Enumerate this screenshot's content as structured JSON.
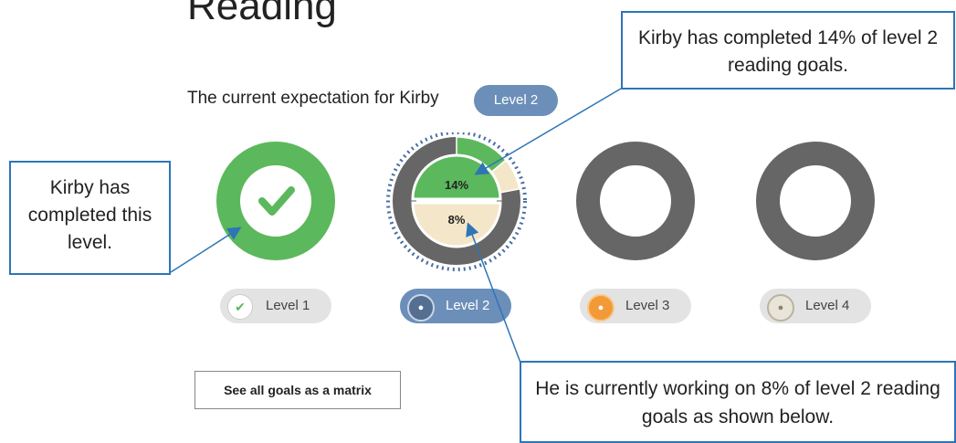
{
  "page": {
    "title": "Reading",
    "expectation_text": "The current expectation for Kirby",
    "expectation_badge": "Level 2"
  },
  "levels": [
    {
      "label": "Level 1",
      "state": "completed",
      "icon": "check-icon"
    },
    {
      "label": "Level 2",
      "state": "current",
      "icon": "level-2-badge-icon",
      "completed_pct": 14,
      "working_pct": 8,
      "completed_label": "14%",
      "working_label": "8%"
    },
    {
      "label": "Level 3",
      "state": "not-started",
      "icon": "level-3-badge-icon"
    },
    {
      "label": "Level 4",
      "state": "not-started",
      "icon": "level-4-badge-icon"
    }
  ],
  "buttons": {
    "matrix": "See all goals as a matrix"
  },
  "callouts": {
    "completed_pct": "Kirby has completed 14% of level 2 reading goals.",
    "completed_level": "Kirby has completed this level.",
    "working_pct": "He is currently working on 8% of level 2 reading goals as shown below."
  },
  "colors": {
    "green": "#5cb85c",
    "grey_ring": "#666666",
    "cream": "#f4e6c8",
    "blue_badge": "#6b8fb9",
    "callout_border": "#2e75b6",
    "orange": "#f29a38"
  }
}
